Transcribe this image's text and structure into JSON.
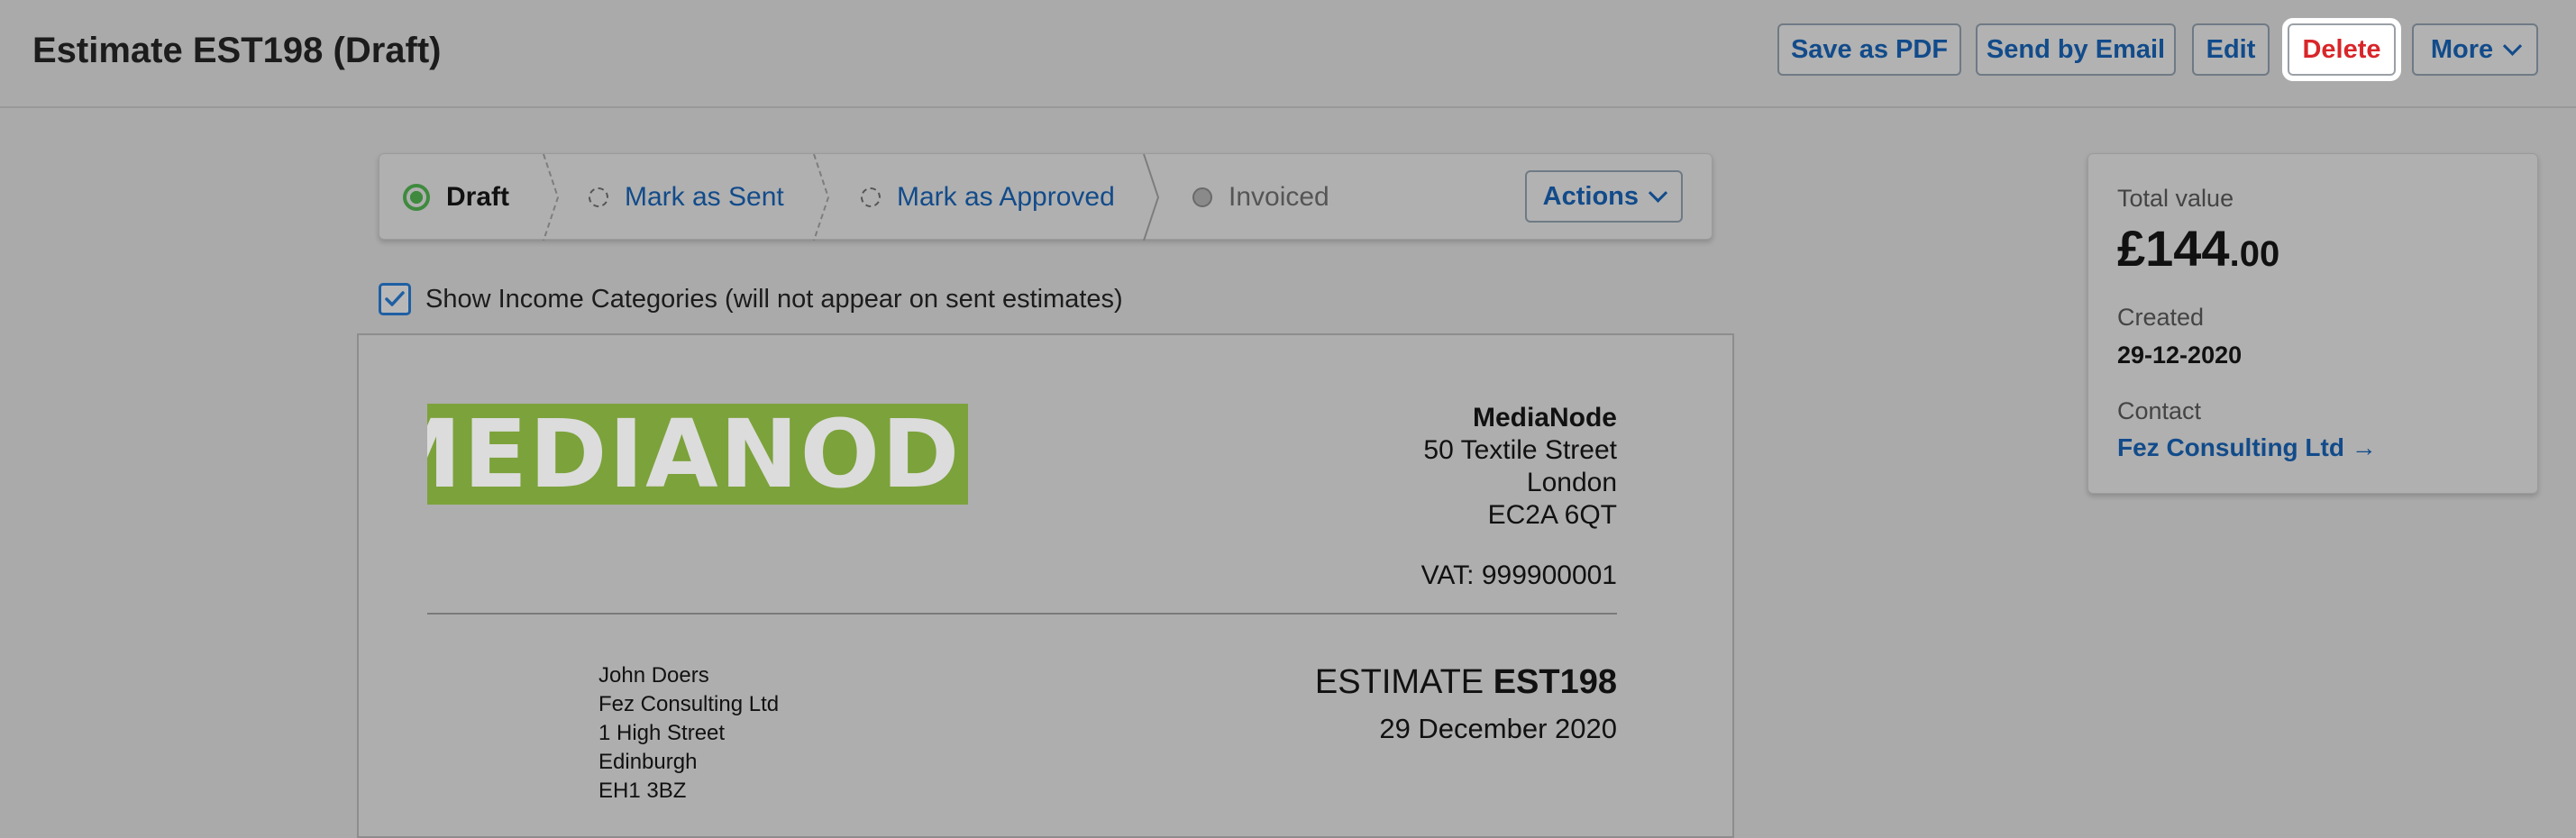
{
  "header": {
    "title": "Estimate EST198 (Draft)",
    "buttons": {
      "save_pdf": "Save as PDF",
      "send_email": "Send by Email",
      "edit": "Edit",
      "delete": "Delete",
      "more": "More"
    }
  },
  "steps": {
    "items": [
      {
        "label": "Draft",
        "state": "active"
      },
      {
        "label": "Mark as Sent",
        "state": "link"
      },
      {
        "label": "Mark as Approved",
        "state": "link"
      },
      {
        "label": "Invoiced",
        "state": "disabled"
      }
    ],
    "actions_label": "Actions"
  },
  "options": {
    "show_income_categories": "Show Income Categories (will not appear on sent estimates)",
    "checked": true
  },
  "document": {
    "logo_text": "MEDIANODE",
    "logo_color": "#7ca23b",
    "company": {
      "name": "MediaNode",
      "street": "50 Textile Street",
      "city": "London",
      "postcode": "EC2A 6QT",
      "vat": "VAT: 999900001"
    },
    "recipient": {
      "name": "John Doers",
      "company": "Fez Consulting Ltd",
      "street": "1 High Street",
      "city": "Edinburgh",
      "postcode": "EH1 3BZ"
    },
    "estimate_label": "ESTIMATE",
    "estimate_number": "EST198",
    "date": "29 December 2020"
  },
  "summary": {
    "total_label": "Total value",
    "total_main": "£144",
    "total_cents": ".00",
    "created_label": "Created",
    "created_value": "29-12-2020",
    "contact_label": "Contact",
    "contact_value": "Fez Consulting Ltd →"
  },
  "colors": {
    "link": "#124b8a",
    "delete": "#d8262a",
    "active_step": "#3f8a3e"
  }
}
